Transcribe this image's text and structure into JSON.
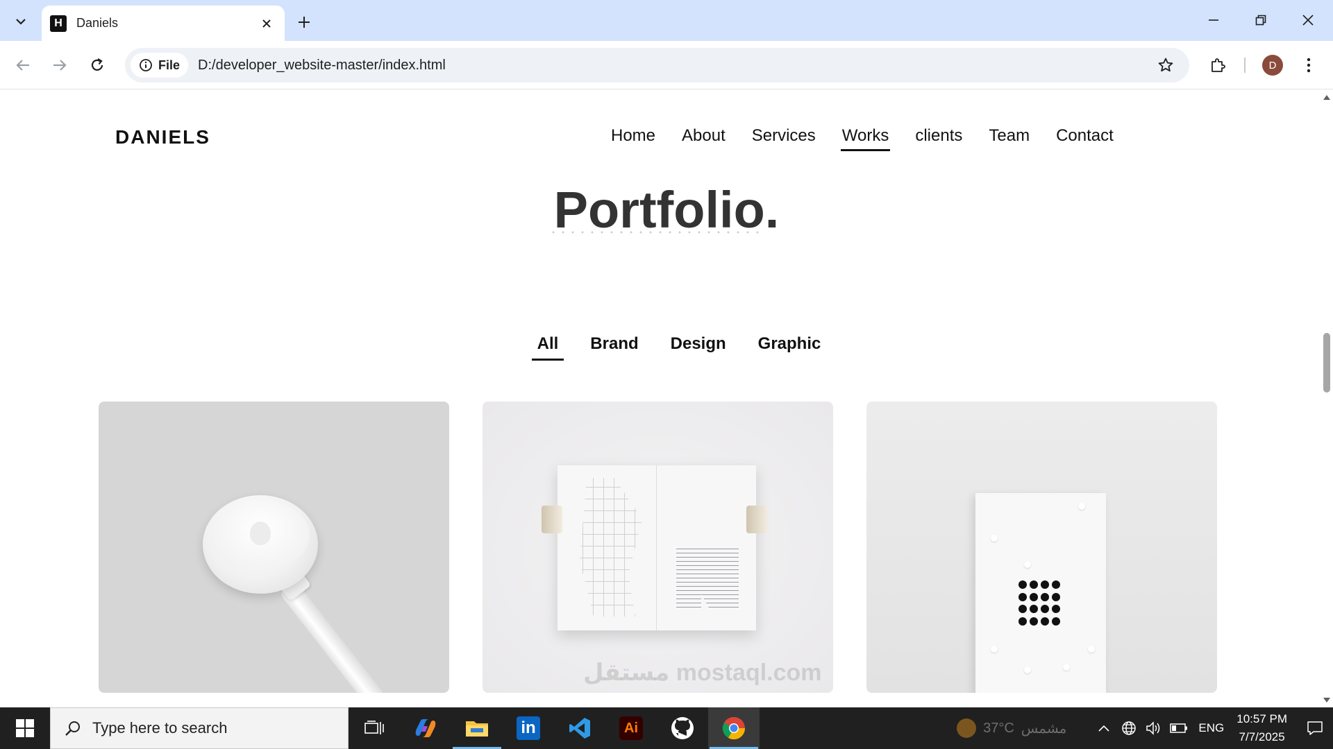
{
  "browser": {
    "tab_title": "Daniels",
    "favicon_letter": "H",
    "site_chip_label": "File",
    "url": "D:/developer_website-master/index.html",
    "avatar_letter": "D"
  },
  "site": {
    "logo": "DANIELS",
    "nav": [
      {
        "label": "Home"
      },
      {
        "label": "About"
      },
      {
        "label": "Services"
      },
      {
        "label": "Works",
        "active": true
      },
      {
        "label": "clients"
      },
      {
        "label": "Team"
      },
      {
        "label": "Contact"
      }
    ]
  },
  "portfolio": {
    "title": "Portfolio.",
    "filters": [
      {
        "label": "All",
        "active": true
      },
      {
        "label": "Brand"
      },
      {
        "label": "Design"
      },
      {
        "label": "Graphic"
      }
    ],
    "items": [
      {
        "subject": "charger"
      },
      {
        "subject": "book"
      },
      {
        "subject": "card"
      }
    ]
  },
  "watermark": "مستقل mostaql.com",
  "taskbar": {
    "search_placeholder": "Type here to search",
    "apps": [
      "task-view",
      "copilot",
      "file-explorer",
      "linkedin",
      "vscode",
      "illustrator",
      "github",
      "chrome"
    ],
    "illustrator_label": "Ai",
    "linkedin_label": "in",
    "weather_temp": "37°C",
    "weather_desc": "مشمس",
    "language": "ENG",
    "time": "10:57 PM",
    "date": "7/7/2025"
  },
  "colors": {
    "tabstrip": "#d3e3fd",
    "taskbar": "#202020",
    "text": "#111111",
    "title": "#333333"
  }
}
